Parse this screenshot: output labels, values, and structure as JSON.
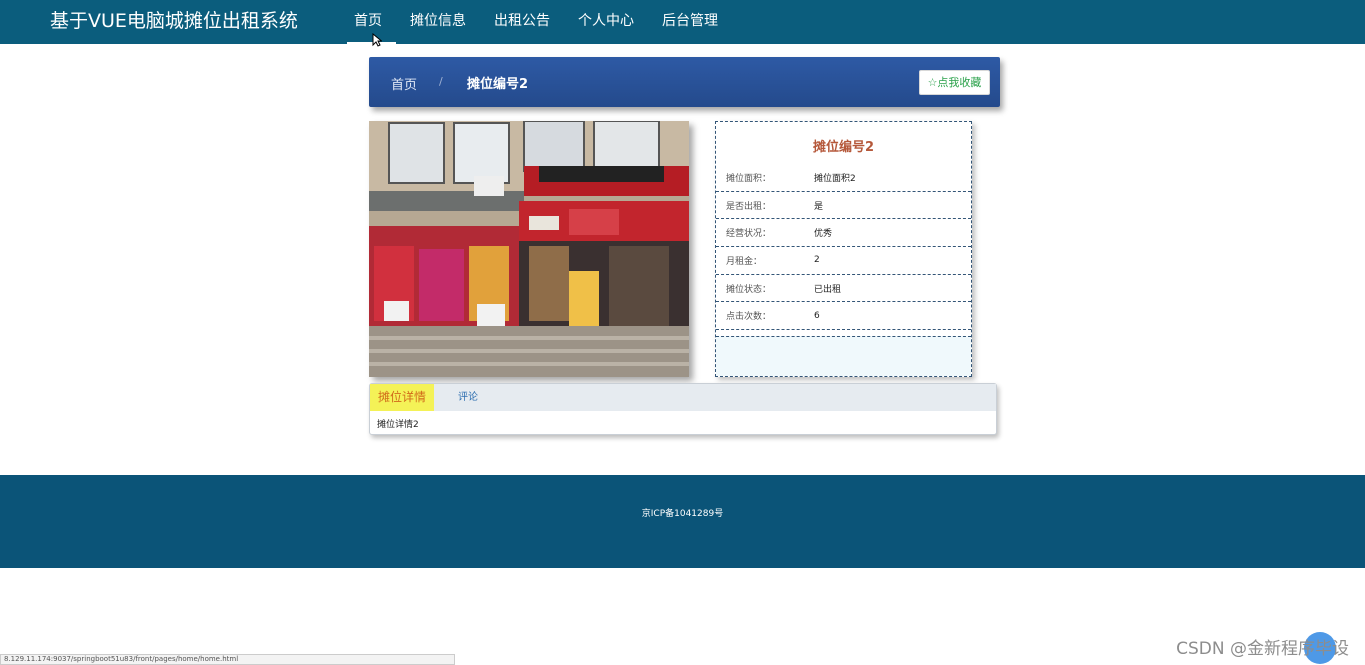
{
  "header": {
    "site_title": "基于VUE电脑城摊位出租系统",
    "nav": [
      {
        "label": "首页",
        "active": true
      },
      {
        "label": "摊位信息",
        "active": false
      },
      {
        "label": "出租公告",
        "active": false
      },
      {
        "label": "个人中心",
        "active": false
      },
      {
        "label": "后台管理",
        "active": false
      }
    ]
  },
  "breadcrumb": {
    "home": "首页",
    "separator": "/",
    "current": "摊位编号2",
    "favorite_button": "☆点我收藏"
  },
  "detail": {
    "title": "摊位编号2",
    "rows": [
      {
        "label": "摊位面积：",
        "value": "摊位面积2"
      },
      {
        "label": "是否出租：",
        "value": "是"
      },
      {
        "label": "经营状况：",
        "value": "优秀"
      },
      {
        "label": "月租金：",
        "value": "2"
      },
      {
        "label": "摊位状态：",
        "value": "已出租"
      },
      {
        "label": "点击次数：",
        "value": "6"
      }
    ]
  },
  "tabs": {
    "items": [
      {
        "label": "摊位详情",
        "active": true
      },
      {
        "label": "评论",
        "active": false
      }
    ],
    "content": "摊位详情2"
  },
  "footer": {
    "icp": "京ICP备1041289号"
  },
  "statusbar": {
    "url": "8.129.11.174:9037/springboot51u83/front/pages/home/home.html"
  },
  "watermark": "CSDN @金新程序毕设",
  "colors": {
    "header_bg": "#0b5d7d",
    "breadcrumb_bg": "#2e5aa5",
    "footer_bg": "#0b5478",
    "title_accent": "#b5583a",
    "tab_active_bg": "#f4f257"
  }
}
